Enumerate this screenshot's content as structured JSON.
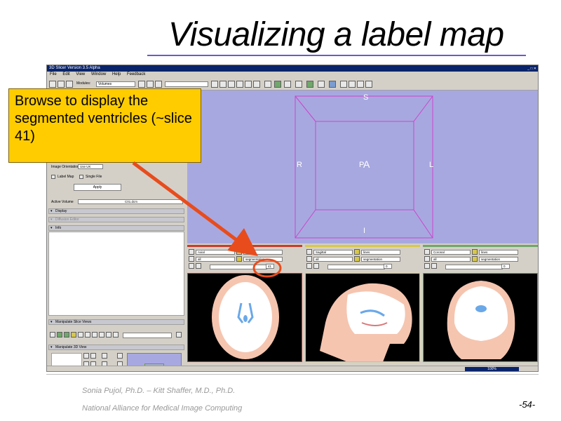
{
  "slide": {
    "title": "Visualizing a label map",
    "callout_text": "Browse to display the segmented ventricles (~slice 41)",
    "footer_authors": "Sonia Pujol, Ph.D. – Kitt Shaffer, M.D., Ph.D.",
    "footer_org": "National Alliance for Medical Image Computing",
    "page_number": "-54-"
  },
  "app": {
    "window_title": "3D Slicer Version 3.5 Alpha",
    "menu": [
      "File",
      "Edit",
      "View",
      "Window",
      "Help",
      "Feedback"
    ],
    "toolbar": {
      "modules_label": "Modules:",
      "modules_value": "Volumes"
    },
    "left_panel": {
      "image_orientation_label": "Image Orientation",
      "image_orientation_value": "Use UK",
      "label_map_label": "Label Map",
      "single_file_label": "Single File",
      "apply_label": "Apply",
      "active_volume_label": "Active Volume",
      "active_volume_value": "C01.dcm",
      "sections": {
        "display": "Display",
        "diffusion": "Diffusion Editor",
        "info": "Info",
        "manipulate_slice": "Manipulate Slice Views",
        "manipulate_3d": "Manipulate 3D View"
      }
    },
    "view3d": {
      "label_s": "S",
      "label_r": "R",
      "label_a": "A",
      "label_l": "L",
      "label_i": "I",
      "label_p": "P"
    },
    "slices": [
      {
        "orientation": "Axial",
        "layer1": "lines",
        "layer2": "all",
        "layer3": "segmentation",
        "slice_value": "41",
        "accent": "#c83c2c"
      },
      {
        "orientation": "Sagittal",
        "layer1": "lines",
        "layer2": "all",
        "layer3": "segmentation",
        "slice_value": "0",
        "accent": "#d8c84a"
      },
      {
        "orientation": "Coronal",
        "layer1": "lines",
        "layer2": "all",
        "layer3": "segmentation",
        "slice_value": "0",
        "accent": "#6fa86a"
      }
    ],
    "status": {
      "progress_text": "100%"
    }
  },
  "colors": {
    "callout_bg": "#ffcc00",
    "arrow": "#e84c1c",
    "view3d_bg": "#a8a8e0",
    "box_lines": "#cc44cc",
    "highlight_ring": "#e84c1c"
  }
}
